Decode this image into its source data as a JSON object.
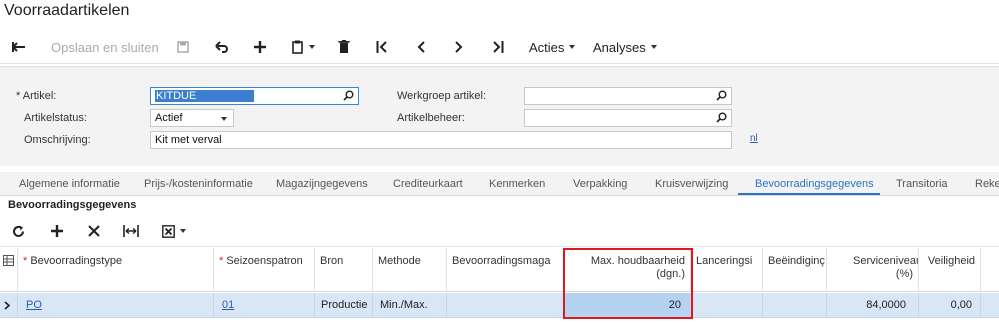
{
  "page": {
    "title": "Voorraadartikelen"
  },
  "toolbar": {
    "save_close": "Opslaan en sluiten",
    "actions": "Acties",
    "analyses": "Analyses"
  },
  "form": {
    "artikel_label": "Artikel:",
    "artikel_value": "KITDUE",
    "status_label": "Artikelstatus:",
    "status_value": "Actief",
    "omschrijving_label": "Omschrijving:",
    "omschrijving_value": "Kit met verval",
    "werkgroep_label": "Werkgroep artikel:",
    "werkgroep_value": "",
    "beheer_label": "Artikelbeheer:",
    "beheer_value": "",
    "language_link": "nl"
  },
  "tabs": [
    "Algemene informatie",
    "Prijs-/kosteninformatie",
    "Magazijngegevens",
    "Crediteurkaart",
    "Kenmerken",
    "Verpakking",
    "Kruisverwijzing",
    "Bevoorradingsgegevens",
    "Transitoria",
    "Reke"
  ],
  "active_tab": "Bevoorradingsgegevens",
  "section": {
    "title": "Bevoorradingsgegevens"
  },
  "grid": {
    "columns": [
      "Bevoorradingstype",
      "Seizoenspatron",
      "Bron",
      "Methode",
      "Bevoorradingsmaga",
      "Max. houdbaarheid (dgn.)",
      "Lanceringsi",
      "Beëindiginç",
      "Serviceniveau (%)",
      "Veiligheid"
    ],
    "rows": [
      {
        "type": "PO",
        "seizoen": "01",
        "bron": "Productie",
        "methode": "Min./Max.",
        "magazijn": "",
        "max_houdbaarheid": "20",
        "lancering": "",
        "beeindiging": "",
        "serviceniveau": "84,0000",
        "veiligheid": "0,00"
      }
    ]
  },
  "colors": {
    "accent": "#2a73c6",
    "highlight": "#e0181e",
    "row_selected": "#d9e6f5"
  }
}
